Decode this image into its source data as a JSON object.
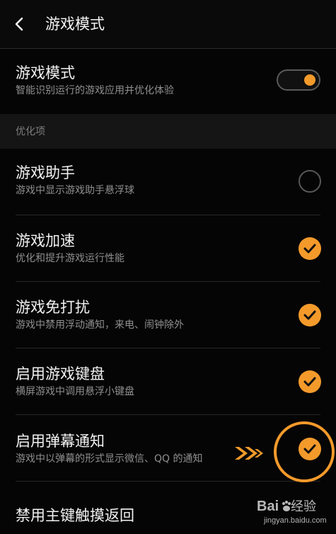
{
  "header": {
    "title": "游戏模式"
  },
  "game_mode": {
    "title": "游戏模式",
    "subtitle": "智能识别运行的游戏应用并优化体验",
    "enabled": true
  },
  "section": {
    "label": "优化项"
  },
  "options": [
    {
      "title": "游戏助手",
      "subtitle": "游戏中显示游戏助手悬浮球",
      "checked": false
    },
    {
      "title": "游戏加速",
      "subtitle": "优化和提升游戏运行性能",
      "checked": true
    },
    {
      "title": "游戏免打扰",
      "subtitle": "游戏中禁用浮动通知，来电、闹钟除外",
      "checked": true
    },
    {
      "title": "启用游戏键盘",
      "subtitle": "横屏游戏中调用悬浮小键盘",
      "checked": true
    },
    {
      "title": "启用弹幕通知",
      "subtitle": "游戏中以弹幕的形式显示微信、QQ 的通知",
      "checked": true
    },
    {
      "title": "禁用主键触摸返回",
      "subtitle": "",
      "checked": null
    }
  ],
  "watermark": {
    "logo_text": "Bai",
    "site_text": "经验",
    "url": "jingyan.baidu.com"
  },
  "colors": {
    "accent": "#f39a2b",
    "background": "#050505",
    "section_background": "#151515",
    "subtitle_text": "#8f8f8f"
  }
}
